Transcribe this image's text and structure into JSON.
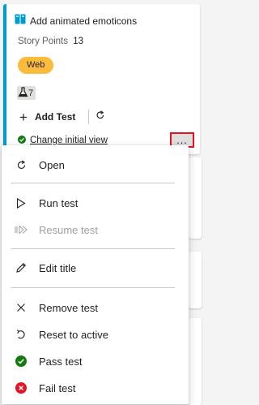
{
  "card": {
    "title": "Add animated emoticons",
    "points_label": "Story Points",
    "points_value": "13",
    "tag": "Web",
    "test_count": "7",
    "add_test_label": "Add Test",
    "initial_view_link": "Change initial view",
    "more_glyph": "...",
    "accent_color": "#009ccc",
    "tag_color": "#fbbc3d",
    "title_icon": "book-icon"
  },
  "menu": {
    "items": [
      {
        "label": "Open",
        "icon": "refresh-icon",
        "enabled": true
      },
      {
        "label": "Run test",
        "icon": "play-icon",
        "enabled": true
      },
      {
        "label": "Resume test",
        "icon": "resume-icon",
        "enabled": false
      },
      {
        "label": "Edit title",
        "icon": "pencil-icon",
        "enabled": true
      },
      {
        "label": "Remove test",
        "icon": "close-icon",
        "enabled": true
      },
      {
        "label": "Reset to active",
        "icon": "undo-icon",
        "enabled": true
      },
      {
        "label": "Pass test",
        "icon": "check-circle-icon",
        "enabled": true,
        "color": "#107c10"
      },
      {
        "label": "Fail test",
        "icon": "x-circle-icon",
        "enabled": true,
        "color": "#e81123"
      }
    ]
  }
}
